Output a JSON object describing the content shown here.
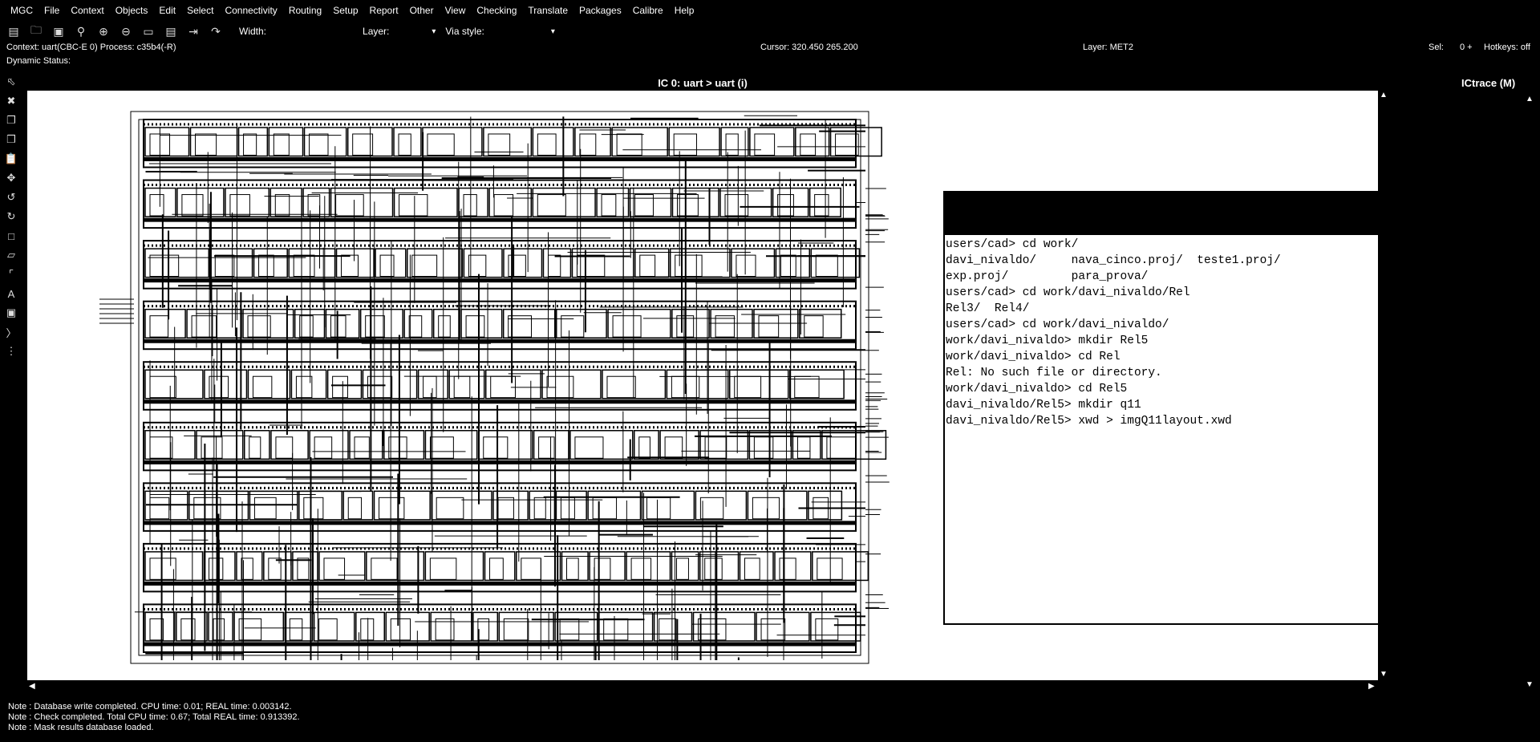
{
  "menu": [
    "MGC",
    "File",
    "Context",
    "Objects",
    "Edit",
    "Select",
    "Connectivity",
    "Routing",
    "Setup",
    "Report",
    "Other",
    "View",
    "Checking",
    "Translate",
    "Packages",
    "Calibre",
    "Help"
  ],
  "toolbar": {
    "width_label": "Width:",
    "layer_label": "Layer:",
    "via_label": "Via style:",
    "icons": [
      "window-icon",
      "open-folder-icon",
      "save-icon",
      "zoom-fit-icon",
      "zoom-in-icon",
      "zoom-out-icon",
      "eraser-icon",
      "panel-icon",
      "insert-icon",
      "route-icon"
    ]
  },
  "status": {
    "context": "Context: uart(CBC-E 0)  Process: c35b4(-R)",
    "cursor": "Cursor: 320.450  265.200",
    "layer": "Layer: MET2",
    "sel_label": "Sel:",
    "sel_value": "0 +",
    "hotkeys": "Hotkeys: off",
    "dynamic": "Dynamic Status:"
  },
  "palette_icons": [
    "select-icon",
    "delete-icon",
    "copy-icon",
    "duplicate-icon",
    "paste-icon",
    "move-icon",
    "undo-icon",
    "redo-icon",
    "add-shape-icon",
    "add-polygon-icon",
    "add-path-icon",
    "add-text-icon",
    "add-instance-icon",
    "ruler-icon",
    "list-icon"
  ],
  "canvas": {
    "title": "IC 0: uart > uart (i)"
  },
  "ictrace": {
    "title": "ICtrace (M)",
    "lines": [
      "users/cad> cd work/",
      "davi_nivaldo/     nava_cinco.proj/  teste1.proj/",
      "exp.proj/         para_prova/",
      "users/cad> cd work/davi_nivaldo/Rel",
      "Rel3/  Rel4/",
      "users/cad> cd work/davi_nivaldo/",
      "work/davi_nivaldo> mkdir Rel5",
      "work/davi_nivaldo> cd Rel",
      "Rel: No such file or directory.",
      "work/davi_nivaldo> cd Rel5",
      "davi_nivaldo/Rel5> mkdir q11",
      "davi_nivaldo/Rel5> xwd > imgQ11layout.xwd"
    ]
  },
  "messages": [
    "Note : Database write completed. CPU time: 0.01; REAL time: 0.003142.",
    "Note : Check completed. Total CPU time: 0.67; Total REAL time: 0.913392.",
    "Note : Mask results database loaded."
  ]
}
